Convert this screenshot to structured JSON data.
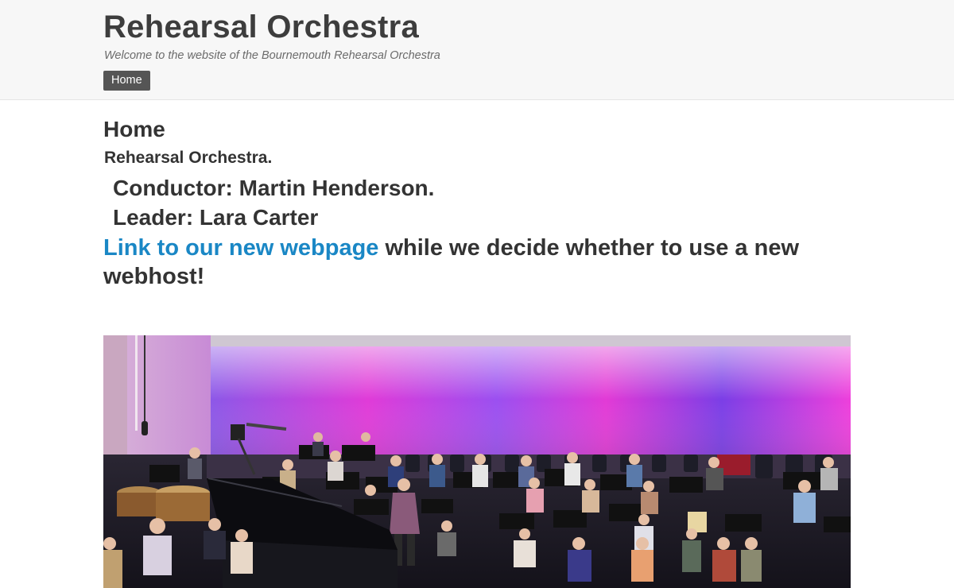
{
  "header": {
    "site_title": "Rehearsal Orchestra",
    "tagline": "Welcome to the website of the Bournemouth Rehearsal Orchestra",
    "nav": [
      {
        "label": "Home"
      }
    ]
  },
  "main": {
    "page_heading": "Home",
    "orchestra_name": "Rehearsal Orchestra.",
    "conductor": "Conductor: Martin Henderson.",
    "leader": "Leader: Lara Carter",
    "notice_link": "Link to our new webpage",
    "notice_text": " while we decide whether to use a new webhost!"
  },
  "photo": {
    "subject": "orchestra-rehearsal-photo"
  },
  "colors": {
    "header_bg": "#f7f7f7",
    "nav_active_bg": "#555555",
    "link": "#1a87c5",
    "text": "#333333",
    "stage_magenta": "#e02ad2",
    "stage_purple": "#7a3ee0"
  }
}
